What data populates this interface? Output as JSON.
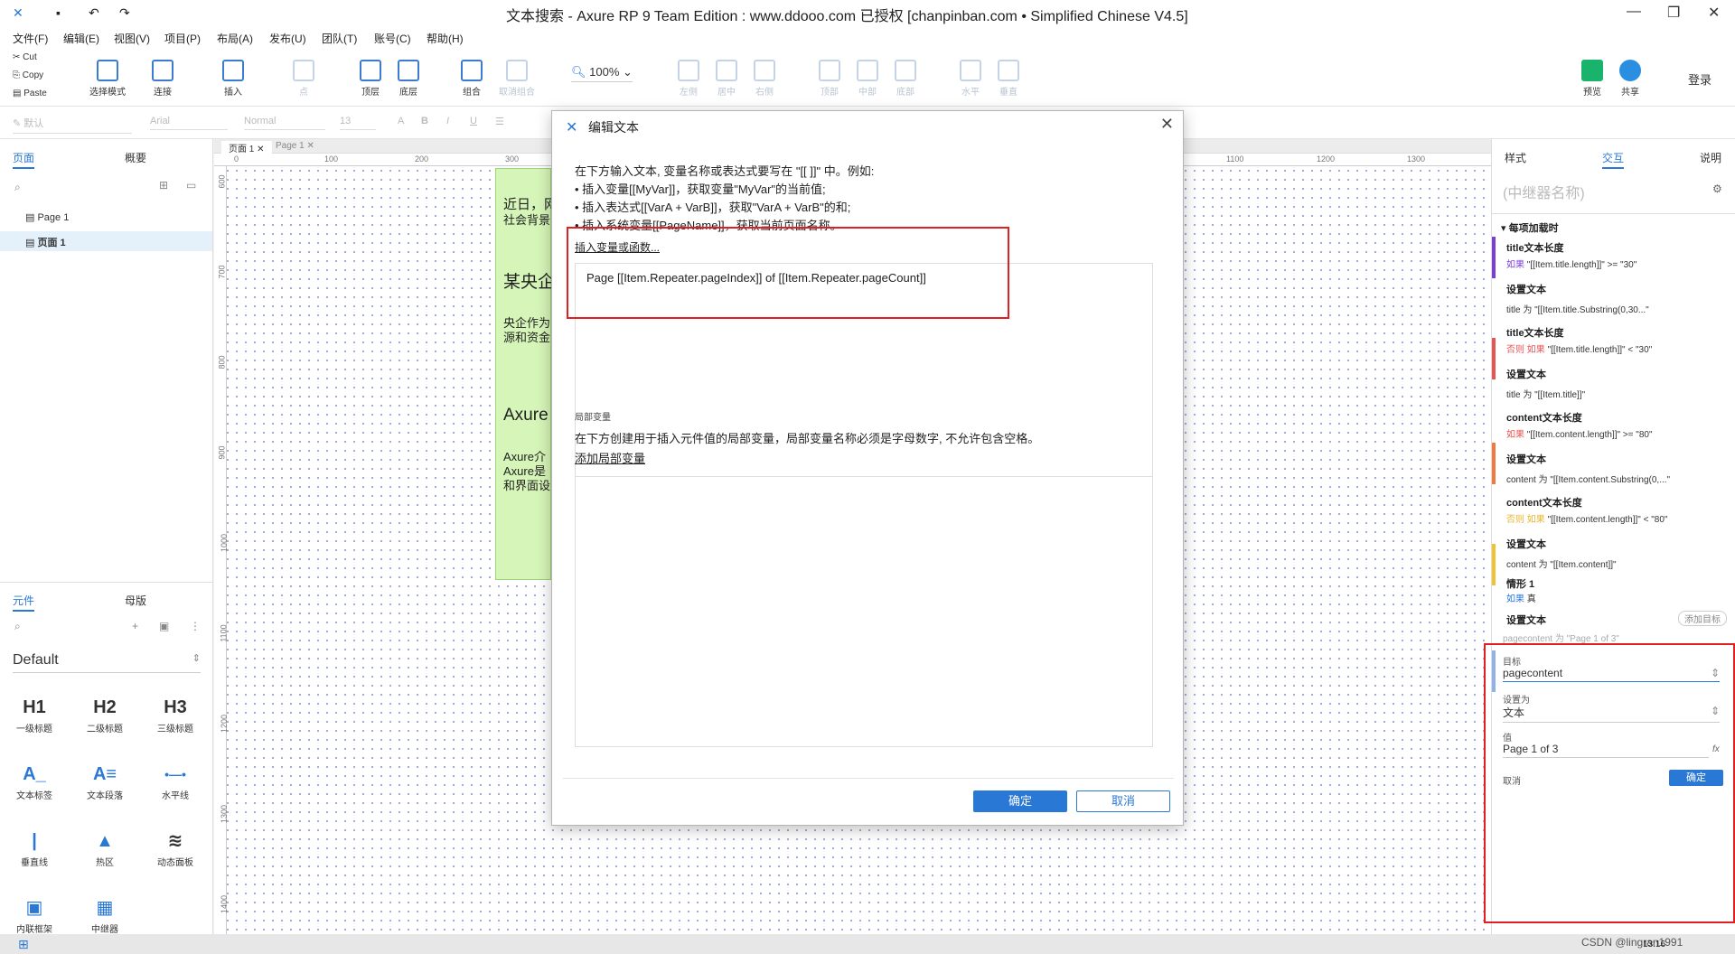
{
  "window": {
    "title": "文本搜索 - Axure RP 9 Team Edition : www.ddooo.com 已授权    [chanpinban.com • Simplified Chinese V4.5]"
  },
  "menu": [
    "文件(F)",
    "编辑(E)",
    "视图(V)",
    "项目(P)",
    "布局(A)",
    "发布(U)",
    "团队(T)",
    "账号(C)",
    "帮助(H)"
  ],
  "clipboard": {
    "cut": "Cut",
    "copy": "Copy",
    "paste": "Paste"
  },
  "toolbar": {
    "select_mode": "选择模式",
    "connect": "连接",
    "insert": "插入",
    "point": "点",
    "top_layer": "顶层",
    "bottom_layer": "底层",
    "group": "组合",
    "ungroup": "取消组合",
    "zoom": "100%",
    "left": "左侧",
    "center": "居中",
    "right": "右侧",
    "top": "顶部",
    "middle": "中部",
    "bottom": "底部",
    "horizontal": "水平",
    "vertical": "垂直",
    "preview": "预览",
    "share": "共享",
    "login": "登录"
  },
  "format": {
    "style": "默认",
    "font": "Arial",
    "weight": "Normal",
    "size": "13"
  },
  "left_panel": {
    "tab_pages": "页面",
    "tab_outline": "概要",
    "pages": [
      "Page 1",
      "页面 1"
    ],
    "tab_widgets": "元件",
    "tab_masters": "母版",
    "library": "Default",
    "widgets": [
      {
        "glyph": "H1",
        "label": "一级标题"
      },
      {
        "glyph": "H2",
        "label": "二级标题"
      },
      {
        "glyph": "H3",
        "label": "三级标题"
      },
      {
        "glyph": "A_",
        "label": "文本标签"
      },
      {
        "glyph": "A≡",
        "label": "文本段落"
      },
      {
        "glyph": "•—•",
        "label": "水平线"
      },
      {
        "glyph": "|",
        "label": "垂直线"
      },
      {
        "glyph": "▲",
        "label": "热区"
      },
      {
        "glyph": "≋",
        "label": "动态面板"
      },
      {
        "glyph": "▣",
        "label": "内联框架"
      },
      {
        "glyph": "▦",
        "label": "中继器"
      }
    ]
  },
  "doc_tabs": [
    "页面 1",
    "Page 1"
  ],
  "ruler_top": [
    "0",
    "100",
    "200",
    "300",
    "1100",
    "1200",
    "1300"
  ],
  "ruler_left": [
    "600",
    "700",
    "800",
    "900",
    "1000",
    "1100",
    "1200",
    "1300",
    "1400"
  ],
  "canvas_text": [
    "近日，网",
    "社会背景",
    "某央企",
    "央企作为",
    "源和资金",
    "Axure",
    "Axure介",
    "Axure是",
    "和界面设"
  ],
  "dialog": {
    "title": "编辑文本",
    "intro": "在下方输入文本, 变量名称或表达式要写在 \"[[ ]]\" 中。例如:",
    "ex1": "• 插入变量[[MyVar]]，获取变量\"MyVar\"的当前值;",
    "ex2": "• 插入表达式[[VarA + VarB]]，获取\"VarA + VarB\"的和;",
    "ex3": "• 插入系统变量[[PageName]]，获取当前页面名称。",
    "insert_link": "插入变量或函数...",
    "text_value": "Page [[Item.Repeater.pageIndex]] of [[Item.Repeater.pageCount]]",
    "local_vars_title": "局部变量",
    "local_vars_desc": "在下方创建用于插入元件值的局部变量，局部变量名称必须是字母数字, 不允许包含空格。",
    "add_local_var": "添加局部变量",
    "ok": "确定",
    "cancel": "取消"
  },
  "right_panel": {
    "tab_style": "样式",
    "tab_interaction": "交互",
    "tab_notes": "说明",
    "repeater_name_placeholder": "(中继器名称)",
    "event": "每项加载时",
    "cases": [
      {
        "name": "title文本长度",
        "cond_kw": "如果",
        "cond": "\"[[Item.title.length]]\" >= \"30\"",
        "action": "设置文本",
        "detail": "title 为 \"[[Item.title.Substring(0,30...\""
      },
      {
        "name": "title文本长度",
        "cond_kw": "否则 如果",
        "cond": "\"[[Item.title.length]]\" < \"30\"",
        "action": "设置文本",
        "detail": "title 为 \"[[Item.title]]\""
      },
      {
        "name": "content文本长度",
        "cond_kw": "如果",
        "cond": "\"[[Item.content.length]]\" >= \"80\"",
        "action": "设置文本",
        "detail": "content 为 \"[[Item.content.Substring(0,...\""
      },
      {
        "name": "content文本长度",
        "cond_kw": "否则 如果",
        "cond": "\"[[Item.content.length]]\" < \"80\"",
        "action": "设置文本",
        "detail": "content 为 \"[[Item.content]]\""
      }
    ],
    "case5": {
      "name": "情形 1",
      "cond_kw": "如果",
      "cond": "真",
      "action": "设置文本",
      "add_target": "添加目标",
      "summary": "pagecontent 为 \"Page 1 of 3\"",
      "target_label": "目标",
      "target_value": "pagecontent",
      "set_to_label": "设置为",
      "set_to_value": "文本",
      "value_label": "值",
      "value": "Page 1 of 3",
      "fx": "fx",
      "cancel": "取消",
      "ok": "确定"
    }
  },
  "taskbar": {
    "time": "13:16",
    "watermark": "CSDN @lingran1991"
  }
}
